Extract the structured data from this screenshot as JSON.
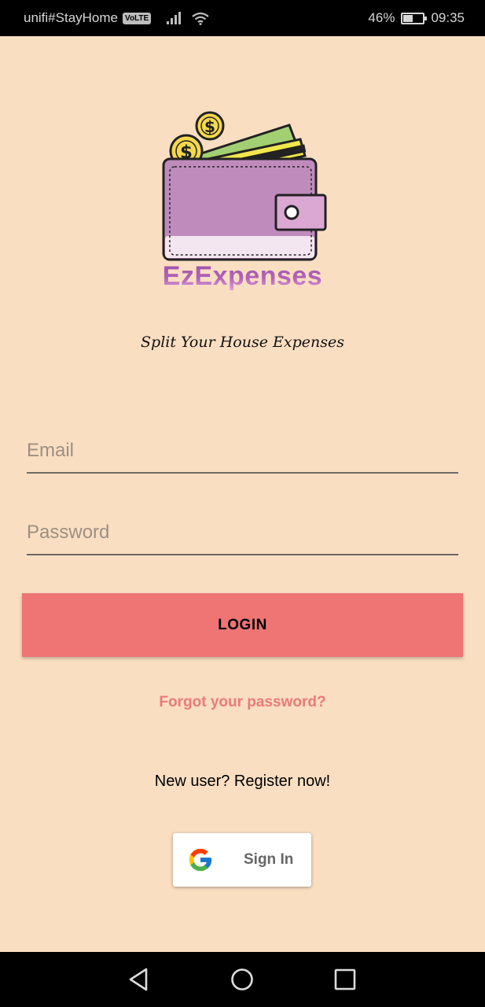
{
  "status_bar": {
    "carrier": "unifi#StayHome",
    "volte_badge": "VoLTE",
    "battery": "46%",
    "battery_level": 0.46,
    "time": "09:35"
  },
  "app": {
    "name": "EzExpenses",
    "tagline": "Split Your House Expenses"
  },
  "form": {
    "email_placeholder": "Email",
    "email_value": "",
    "password_placeholder": "Password",
    "password_value": "",
    "login_label": "LOGIN",
    "forgot_label": "Forgot your password?",
    "register_label": "New user? Register now!",
    "google_label": "Sign In"
  },
  "colors": {
    "background": "#fadec2",
    "accent": "#ef7474",
    "brand": "#a857b2"
  },
  "icons": {
    "logo": "wallet-icon",
    "google": "google-icon",
    "back": "back-triangle-icon",
    "home": "home-circle-icon",
    "recent": "recent-square-icon"
  }
}
